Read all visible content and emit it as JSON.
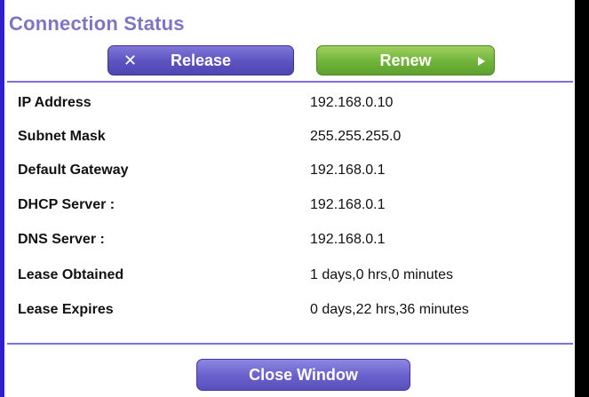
{
  "title": "Connection Status",
  "buttons": {
    "release": "Release",
    "renew": "Renew",
    "close": "Close Window"
  },
  "icons": {
    "release": "close-x-icon",
    "renew": "play-arrow-icon"
  },
  "colors": {
    "title": "#7e75c4",
    "release_button": "#5c52c0",
    "renew_button": "#6fb43a",
    "close_button": "#6a60cc",
    "divider": "#7a71d9",
    "left_border": "#2f1fd0"
  },
  "rows": [
    {
      "label": "IP Address",
      "value": "192.168.0.10"
    },
    {
      "label": "Subnet Mask",
      "value": "255.255.255.0"
    },
    {
      "label": "Default Gateway",
      "value": "192.168.0.1"
    },
    {
      "label": "DHCP Server :",
      "value": "192.168.0.1"
    },
    {
      "label": "DNS Server :",
      "value": "192.168.0.1"
    },
    {
      "label": "Lease Obtained",
      "value": "1 days,0 hrs,0 minutes"
    },
    {
      "label": "Lease Expires",
      "value": "0 days,22 hrs,36 minutes"
    }
  ]
}
